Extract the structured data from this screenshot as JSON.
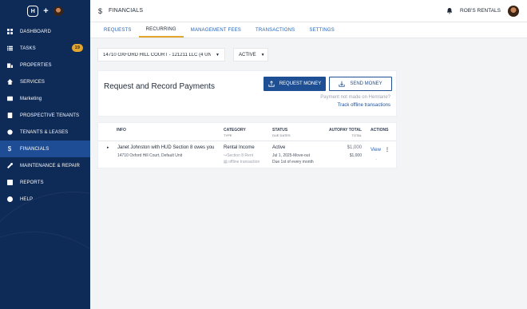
{
  "sidebar": {
    "items": [
      {
        "label": "DASHBOARD",
        "icon": "dashboard-icon"
      },
      {
        "label": "TASKS",
        "icon": "tasks-icon",
        "badge": "19"
      },
      {
        "label": "PROPERTIES",
        "icon": "properties-icon"
      },
      {
        "label": "SERVICES",
        "icon": "services-icon"
      },
      {
        "label": "Marketing",
        "icon": "marketing-icon"
      },
      {
        "label": "PROSPECTIVE TENANTS",
        "icon": "prospective-tenants-icon"
      },
      {
        "label": "TENANTS & LEASES",
        "icon": "tenants-leases-icon"
      },
      {
        "label": "FINANCIALS",
        "icon": "financials-icon"
      },
      {
        "label": "MAINTENANCE & REPAIR",
        "icon": "maintenance-icon"
      },
      {
        "label": "REPORTS",
        "icon": "reports-icon"
      },
      {
        "label": "HELP",
        "icon": "help-icon"
      }
    ]
  },
  "header": {
    "title": "FINANCIALS",
    "account": "ROB'S RENTALS"
  },
  "tabs": [
    "REQUESTS",
    "RECURRING",
    "MANAGEMENT FEES",
    "TRANSACTIONS",
    "SETTINGS"
  ],
  "filters": {
    "property": "14710 OXFORD HILL COURT - 121211 LLC (4 UN/",
    "status": "ACTIVE"
  },
  "request_card": {
    "title": "Request and Record Payments",
    "request_button": "REQUEST MONEY",
    "send_button": "SEND MONEY",
    "offline_question": "Payment not made on Hemlane?",
    "offline_link": "Track offline transactions"
  },
  "table": {
    "headers": {
      "info": "INFO",
      "category": "CATEGORY",
      "category_sub": "TYPE",
      "status": "STATUS",
      "status_sub": "DUE DATES",
      "autopay": "AUTOPAY TOTAL",
      "autopay_sub": "TOTAL",
      "actions": "ACTIONS"
    },
    "rows": [
      {
        "title": "Janet Johnston with HUD Section 8 owes you",
        "subtitle": "14710 Oxford Hill Court, Default Unit",
        "category": "Rental Income",
        "type": "↪Section 8 Rent",
        "offline": "offline transaction",
        "status": "Active",
        "due1": "Jul 1, 2025-Move-out",
        "due2": "Due 1st of every month",
        "autopay_total": "$1,000",
        "total": "$1,000",
        "dash": "-",
        "action": "View"
      }
    ]
  }
}
